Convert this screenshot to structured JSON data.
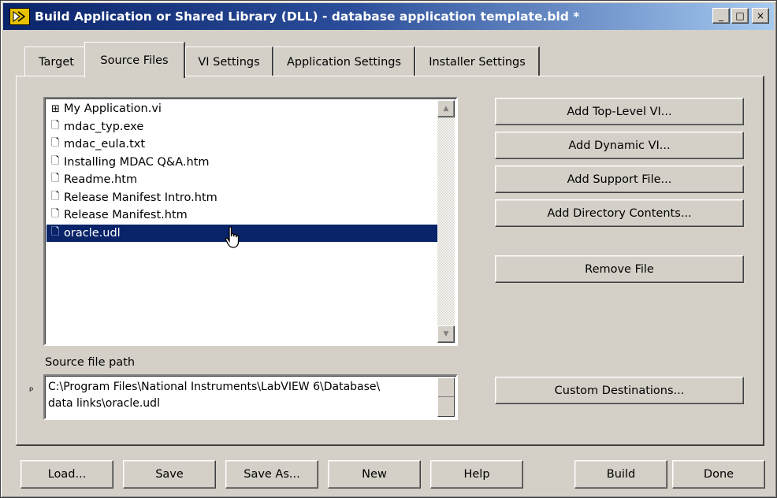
{
  "window": {
    "title": "Build Application or Shared Library (DLL) - database application template.bld *",
    "minimize_glyph": "_",
    "maximize_glyph": "□",
    "close_glyph": "×"
  },
  "tabs": [
    {
      "label": "Target",
      "active": false
    },
    {
      "label": "Source Files",
      "active": true
    },
    {
      "label": "VI Settings",
      "active": false
    },
    {
      "label": "Application Settings",
      "active": false
    },
    {
      "label": "Installer Settings",
      "active": false
    }
  ],
  "source_list": {
    "items": [
      {
        "icon": "plus-box-icon",
        "glyph": "⊞",
        "label": "My Application.vi",
        "selected": false
      },
      {
        "icon": "file-icon",
        "glyph": "🗋",
        "label": "mdac_typ.exe",
        "selected": false
      },
      {
        "icon": "file-icon",
        "glyph": "🗋",
        "label": "mdac_eula.txt",
        "selected": false
      },
      {
        "icon": "file-icon",
        "glyph": "🗋",
        "label": "Installing MDAC Q&A.htm",
        "selected": false
      },
      {
        "icon": "file-icon",
        "glyph": "🗋",
        "label": "Readme.htm",
        "selected": false
      },
      {
        "icon": "file-icon",
        "glyph": "🗋",
        "label": "Release Manifest Intro.htm",
        "selected": false
      },
      {
        "icon": "file-icon",
        "glyph": "🗋",
        "label": "Release Manifest.htm",
        "selected": false
      },
      {
        "icon": "file-icon",
        "glyph": "🗋",
        "label": "oracle.udl",
        "selected": true
      }
    ],
    "scroll_up_glyph": "▲",
    "scroll_down_glyph": "▼"
  },
  "source_path": {
    "label": "Source file path",
    "indicator_glyph": "ᵖ",
    "value_line1": "C:\\Program Files\\National Instruments\\LabVIEW 6\\Database\\",
    "value_line2": "data links\\oracle.udl"
  },
  "side_buttons": {
    "add_top_level_vi": "Add Top-Level VI...",
    "add_dynamic_vi": "Add Dynamic VI...",
    "add_support_file": "Add Support File...",
    "add_directory_contents": "Add Directory Contents...",
    "remove_file": "Remove File",
    "custom_destinations": "Custom Destinations..."
  },
  "bottom_buttons": {
    "load": "Load...",
    "save": "Save",
    "save_as": "Save As...",
    "new": "New",
    "help": "Help",
    "build": "Build",
    "done": "Done"
  },
  "colors": {
    "titlebar": "#0a246a",
    "selection": "#0a246a",
    "face": "#d4d0c8"
  }
}
